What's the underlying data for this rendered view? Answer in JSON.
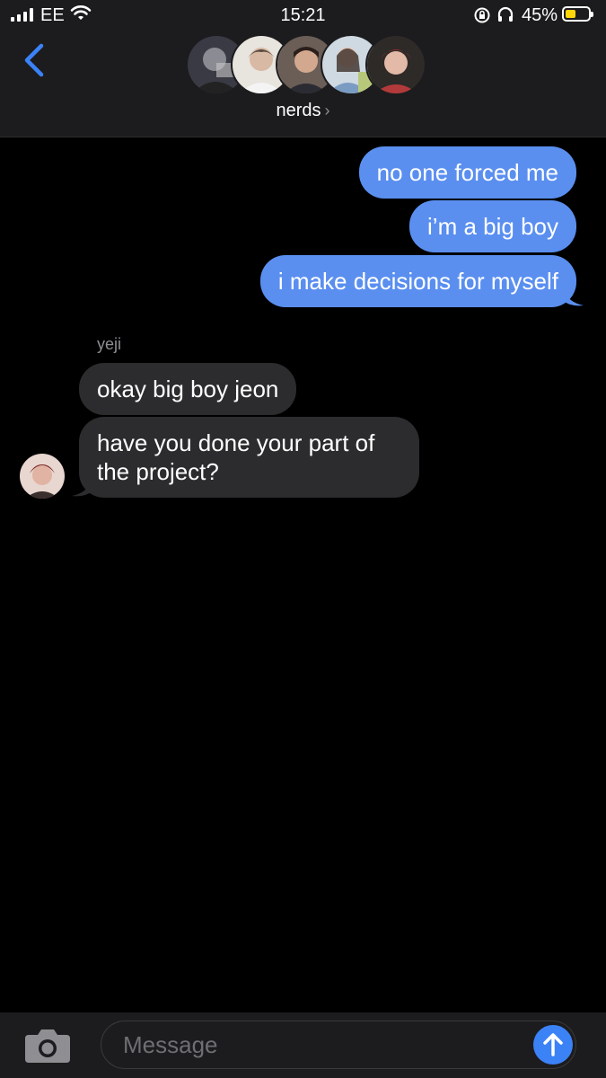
{
  "status_bar": {
    "carrier": "EE",
    "time": "15:21",
    "battery_percent_label": "45%",
    "battery_level": 0.45
  },
  "header": {
    "group_name": "nerds",
    "chevron": "›",
    "back_icon": "chevron-left-icon",
    "participant_avatars": [
      "avatar-1",
      "avatar-2",
      "avatar-3",
      "avatar-4",
      "avatar-5"
    ]
  },
  "messages": {
    "sent": [
      "no one forced me",
      "i’m a big boy",
      "i make decisions for myself"
    ],
    "sender_name": "yeji",
    "received": [
      "okay big boy jeon",
      "have you done your part of the project?"
    ]
  },
  "input": {
    "placeholder": "Message",
    "camera_icon": "camera-icon",
    "send_icon": "arrow-up-icon"
  },
  "colors": {
    "sent_bubble": "#5a8ff0",
    "received_bubble": "#2c2c2e",
    "accent": "#3b82f6",
    "battery": "#ffd60a"
  }
}
